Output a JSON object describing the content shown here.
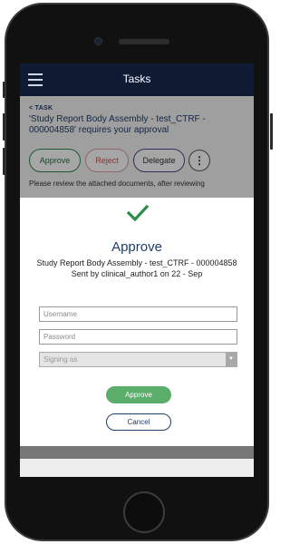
{
  "app": {
    "title": "Tasks"
  },
  "task": {
    "breadcrumb": "< TASK",
    "title": "'Study Report Body Assembly - test_CTRF - 000004858' requires your approval",
    "actions": {
      "approve": "Approve",
      "reject": "Reject",
      "delegate": "Delegate",
      "more": "⋮"
    },
    "body_text": "Please review the attached documents, after reviewing"
  },
  "modal": {
    "title": "Approve",
    "subtitle": "Study Report Body Assembly - test_CTRF - 000004858",
    "sent_by": "Sent by clinical_author1 on 22 - Sep",
    "username_placeholder": "Username",
    "password_placeholder": "Password",
    "signing_as": "Signing as",
    "approve_label": "Approve",
    "cancel_label": "Cancel"
  },
  "colors": {
    "accent_green": "#5aad6a",
    "check_green": "#2e8b4a",
    "navy": "#1f3d6b",
    "appbar": "#0f1a33"
  },
  "icons": {
    "menu": "hamburger-icon",
    "check": "checkmark-icon",
    "dropdown": "caret-down-icon"
  }
}
